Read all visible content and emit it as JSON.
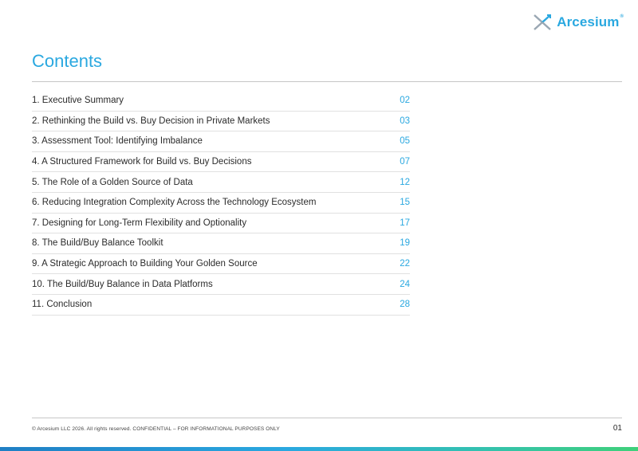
{
  "brand": {
    "name": "Arcesium",
    "registered_mark": "®",
    "accent_color": "#2aa8e0"
  },
  "page_title": "Contents",
  "toc": [
    {
      "label": "1.   Executive Summary",
      "page": "02"
    },
    {
      "label": "2.   Rethinking the Build vs. Buy Decision in Private Markets",
      "page": "03"
    },
    {
      "label": "3.   Assessment Tool: Identifying Imbalance",
      "page": "05"
    },
    {
      "label": "4.   A Structured Framework for Build vs. Buy Decisions",
      "page": "07"
    },
    {
      "label": "5.   The Role of a Golden Source of Data",
      "page": "12"
    },
    {
      "label": "6.    Reducing Integration Complexity Across the Technology Ecosystem",
      "page": "15"
    },
    {
      "label": "7.   Designing for Long-Term Flexibility and Optionality",
      "page": "17"
    },
    {
      "label": "8.   The Build/Buy Balance Toolkit",
      "page": "19"
    },
    {
      "label": "9.   A Strategic Approach to Building Your Golden Source",
      "page": "22"
    },
    {
      "label": "10. The Build/Buy Balance in Data Platforms",
      "page": "24"
    },
    {
      "label": "11.   Conclusion",
      "page": "28"
    }
  ],
  "footer": {
    "text": "© Arcesium LLC 2026. All rights reserved. CONFIDENTIAL – FOR INFORMATIONAL PURPOSES ONLY",
    "page_number": "01"
  }
}
